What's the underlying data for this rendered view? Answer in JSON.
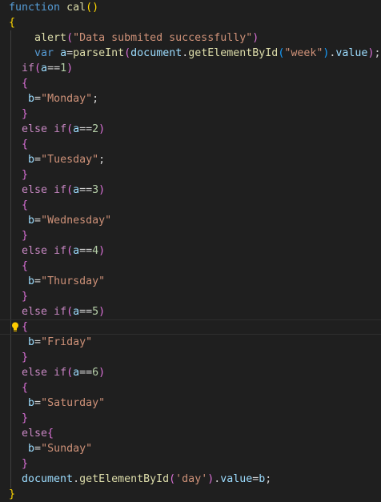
{
  "editor": {
    "lines": [
      {
        "indent": "",
        "tokens": [
          {
            "t": "function",
            "c": "kw"
          },
          {
            "t": " ",
            "c": "plain"
          },
          {
            "t": "cal",
            "c": "fn"
          },
          {
            "t": "()",
            "c": "br1"
          }
        ]
      },
      {
        "indent": "",
        "tokens": [
          {
            "t": "{",
            "c": "br1"
          }
        ]
      },
      {
        "indent": "    ",
        "tokens": [
          {
            "t": "alert",
            "c": "fn"
          },
          {
            "t": "(",
            "c": "br2"
          },
          {
            "t": "\"Data submited successfully\"",
            "c": "str"
          },
          {
            "t": ")",
            "c": "br2"
          }
        ]
      },
      {
        "indent": "    ",
        "tokens": [
          {
            "t": "var",
            "c": "kw"
          },
          {
            "t": " ",
            "c": "plain"
          },
          {
            "t": "a",
            "c": "var"
          },
          {
            "t": "=",
            "c": "plain"
          },
          {
            "t": "parseInt",
            "c": "fn"
          },
          {
            "t": "(",
            "c": "br2"
          },
          {
            "t": "document",
            "c": "var"
          },
          {
            "t": ".",
            "c": "plain"
          },
          {
            "t": "getElementById",
            "c": "fn"
          },
          {
            "t": "(",
            "c": "br3"
          },
          {
            "t": "\"week\"",
            "c": "str"
          },
          {
            "t": ")",
            "c": "br3"
          },
          {
            "t": ".",
            "c": "plain"
          },
          {
            "t": "value",
            "c": "var"
          },
          {
            "t": ")",
            "c": "br2"
          },
          {
            "t": ";",
            "c": "plain"
          }
        ]
      },
      {
        "indent": "  ",
        "tokens": [
          {
            "t": "if",
            "c": "ctl"
          },
          {
            "t": "(",
            "c": "br2"
          },
          {
            "t": "a",
            "c": "var"
          },
          {
            "t": "==",
            "c": "plain"
          },
          {
            "t": "1",
            "c": "num"
          },
          {
            "t": ")",
            "c": "br2"
          }
        ]
      },
      {
        "indent": "  ",
        "tokens": [
          {
            "t": "{",
            "c": "br2"
          }
        ]
      },
      {
        "indent": "   ",
        "tokens": [
          {
            "t": "b",
            "c": "var"
          },
          {
            "t": "=",
            "c": "plain"
          },
          {
            "t": "\"Monday\"",
            "c": "str"
          },
          {
            "t": ";",
            "c": "plain"
          }
        ]
      },
      {
        "indent": "  ",
        "tokens": [
          {
            "t": "}",
            "c": "br2"
          }
        ]
      },
      {
        "indent": "  ",
        "tokens": [
          {
            "t": "else",
            "c": "ctl"
          },
          {
            "t": " ",
            "c": "plain"
          },
          {
            "t": "if",
            "c": "ctl"
          },
          {
            "t": "(",
            "c": "br2"
          },
          {
            "t": "a",
            "c": "var"
          },
          {
            "t": "==",
            "c": "plain"
          },
          {
            "t": "2",
            "c": "num"
          },
          {
            "t": ")",
            "c": "br2"
          }
        ]
      },
      {
        "indent": "  ",
        "tokens": [
          {
            "t": "{",
            "c": "br2"
          }
        ]
      },
      {
        "indent": "   ",
        "tokens": [
          {
            "t": "b",
            "c": "var"
          },
          {
            "t": "=",
            "c": "plain"
          },
          {
            "t": "\"Tuesday\"",
            "c": "str"
          },
          {
            "t": ";",
            "c": "plain"
          }
        ]
      },
      {
        "indent": "  ",
        "tokens": [
          {
            "t": "}",
            "c": "br2"
          }
        ]
      },
      {
        "indent": "  ",
        "tokens": [
          {
            "t": "else",
            "c": "ctl"
          },
          {
            "t": " ",
            "c": "plain"
          },
          {
            "t": "if",
            "c": "ctl"
          },
          {
            "t": "(",
            "c": "br2"
          },
          {
            "t": "a",
            "c": "var"
          },
          {
            "t": "==",
            "c": "plain"
          },
          {
            "t": "3",
            "c": "num"
          },
          {
            "t": ")",
            "c": "br2"
          }
        ]
      },
      {
        "indent": "  ",
        "tokens": [
          {
            "t": "{",
            "c": "br2"
          }
        ]
      },
      {
        "indent": "   ",
        "tokens": [
          {
            "t": "b",
            "c": "var"
          },
          {
            "t": "=",
            "c": "plain"
          },
          {
            "t": "\"Wednesday\"",
            "c": "str"
          }
        ]
      },
      {
        "indent": "  ",
        "tokens": [
          {
            "t": "}",
            "c": "br2"
          }
        ]
      },
      {
        "indent": "  ",
        "tokens": [
          {
            "t": "else",
            "c": "ctl"
          },
          {
            "t": " ",
            "c": "plain"
          },
          {
            "t": "if",
            "c": "ctl"
          },
          {
            "t": "(",
            "c": "br2"
          },
          {
            "t": "a",
            "c": "var"
          },
          {
            "t": "==",
            "c": "plain"
          },
          {
            "t": "4",
            "c": "num"
          },
          {
            "t": ")",
            "c": "br2"
          }
        ]
      },
      {
        "indent": "  ",
        "tokens": [
          {
            "t": "{",
            "c": "br2"
          }
        ]
      },
      {
        "indent": "   ",
        "tokens": [
          {
            "t": "b",
            "c": "var"
          },
          {
            "t": "=",
            "c": "plain"
          },
          {
            "t": "\"Thursday\"",
            "c": "str"
          }
        ]
      },
      {
        "indent": "  ",
        "tokens": [
          {
            "t": "}",
            "c": "br2"
          }
        ]
      },
      {
        "indent": "  ",
        "tokens": [
          {
            "t": "else",
            "c": "ctl"
          },
          {
            "t": " ",
            "c": "plain"
          },
          {
            "t": "if",
            "c": "ctl"
          },
          {
            "t": "(",
            "c": "br2"
          },
          {
            "t": "a",
            "c": "var"
          },
          {
            "t": "==",
            "c": "plain"
          },
          {
            "t": "5",
            "c": "num"
          },
          {
            "t": ")",
            "c": "br2"
          }
        ]
      },
      {
        "indent": "  ",
        "tokens": [
          {
            "t": "{",
            "c": "br2"
          }
        ],
        "current": true
      },
      {
        "indent": "   ",
        "tokens": [
          {
            "t": "b",
            "c": "var"
          },
          {
            "t": "=",
            "c": "plain"
          },
          {
            "t": "\"Friday\"",
            "c": "str"
          }
        ]
      },
      {
        "indent": "  ",
        "tokens": [
          {
            "t": "}",
            "c": "br2"
          }
        ]
      },
      {
        "indent": "  ",
        "tokens": [
          {
            "t": "else",
            "c": "ctl"
          },
          {
            "t": " ",
            "c": "plain"
          },
          {
            "t": "if",
            "c": "ctl"
          },
          {
            "t": "(",
            "c": "br2"
          },
          {
            "t": "a",
            "c": "var"
          },
          {
            "t": "==",
            "c": "plain"
          },
          {
            "t": "6",
            "c": "num"
          },
          {
            "t": ")",
            "c": "br2"
          }
        ]
      },
      {
        "indent": "  ",
        "tokens": [
          {
            "t": "{",
            "c": "br2"
          }
        ]
      },
      {
        "indent": "   ",
        "tokens": [
          {
            "t": "b",
            "c": "var"
          },
          {
            "t": "=",
            "c": "plain"
          },
          {
            "t": "\"Saturday\"",
            "c": "str"
          }
        ]
      },
      {
        "indent": "  ",
        "tokens": [
          {
            "t": "}",
            "c": "br2"
          }
        ]
      },
      {
        "indent": "  ",
        "tokens": [
          {
            "t": "else",
            "c": "ctl"
          },
          {
            "t": "{",
            "c": "br2"
          }
        ]
      },
      {
        "indent": "   ",
        "tokens": [
          {
            "t": "b",
            "c": "var"
          },
          {
            "t": "=",
            "c": "plain"
          },
          {
            "t": "\"Sunday\"",
            "c": "str"
          }
        ]
      },
      {
        "indent": "  ",
        "tokens": [
          {
            "t": "}",
            "c": "br2"
          }
        ]
      },
      {
        "indent": "  ",
        "tokens": [
          {
            "t": "document",
            "c": "var"
          },
          {
            "t": ".",
            "c": "plain"
          },
          {
            "t": "getElementById",
            "c": "fn"
          },
          {
            "t": "(",
            "c": "br2"
          },
          {
            "t": "'day'",
            "c": "str"
          },
          {
            "t": ")",
            "c": "br2"
          },
          {
            "t": ".",
            "c": "plain"
          },
          {
            "t": "value",
            "c": "var"
          },
          {
            "t": "=",
            "c": "plain"
          },
          {
            "t": "b",
            "c": "var"
          },
          {
            "t": ";",
            "c": "plain"
          }
        ]
      },
      {
        "indent": "",
        "tokens": [
          {
            "t": "}",
            "c": "br1"
          }
        ]
      }
    ],
    "lightbulb_icon": "lightbulb-icon"
  },
  "colors": {
    "background": "#1f1f1f",
    "keyword": "#569cd6",
    "control": "#c586c0",
    "function": "#dcdcaa",
    "string": "#ce9178",
    "number": "#b5cea8",
    "variable": "#9cdcfe",
    "bracket_level1": "#ffd700",
    "bracket_level2": "#da70d6",
    "bracket_level3": "#179fff"
  }
}
